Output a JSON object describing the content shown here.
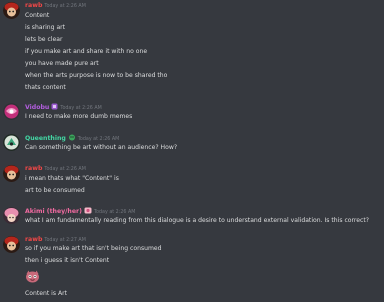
{
  "messages": [
    {
      "user": "rawb",
      "time": "Today at 2:26 AM",
      "color": "#f04747",
      "lines": [
        "Content",
        "is sharing art",
        "lets be clear",
        "if you make art and share it with no one",
        "you have made pure art",
        "when the arts purpose is now to be shared tho",
        "thats content"
      ]
    },
    {
      "user": "Vidobu",
      "time": "Today at 2:26 AM",
      "color": "#b45ee0",
      "badge": "purple-emoji-icon",
      "lines": [
        "I need to make more dumb memes"
      ]
    },
    {
      "user": "Queenthing",
      "time": "Today at 2:26 AM",
      "color": "#43d7a4",
      "badge": "green-emoji-icon",
      "lines": [
        "Can something be art without an audience? How?"
      ]
    },
    {
      "user": "rawb",
      "time": "Today at 2:26 AM",
      "color": "#f04747",
      "lines": [
        "i mean thats what \"Content\" is",
        "art to be consumed"
      ]
    },
    {
      "user": "Akimi (they/her)",
      "time": "Today at 2:26 AM",
      "color": "#f06aa0",
      "badge": "pink-emoji-icon",
      "lines": [
        "what I am fundamentally reading from this dialogue is a desire to understand external validation. Is this correct?"
      ]
    },
    {
      "user": "rawb",
      "time": "Today at 2:27 AM",
      "color": "#f04747",
      "lines": [
        "so if you make art that isn't being consumed",
        "then i guess it isn't Content",
        "Content is Art"
      ]
    }
  ],
  "colors": {
    "background": "#36393f",
    "text": "#dcddde",
    "timestamp": "#72767d"
  }
}
